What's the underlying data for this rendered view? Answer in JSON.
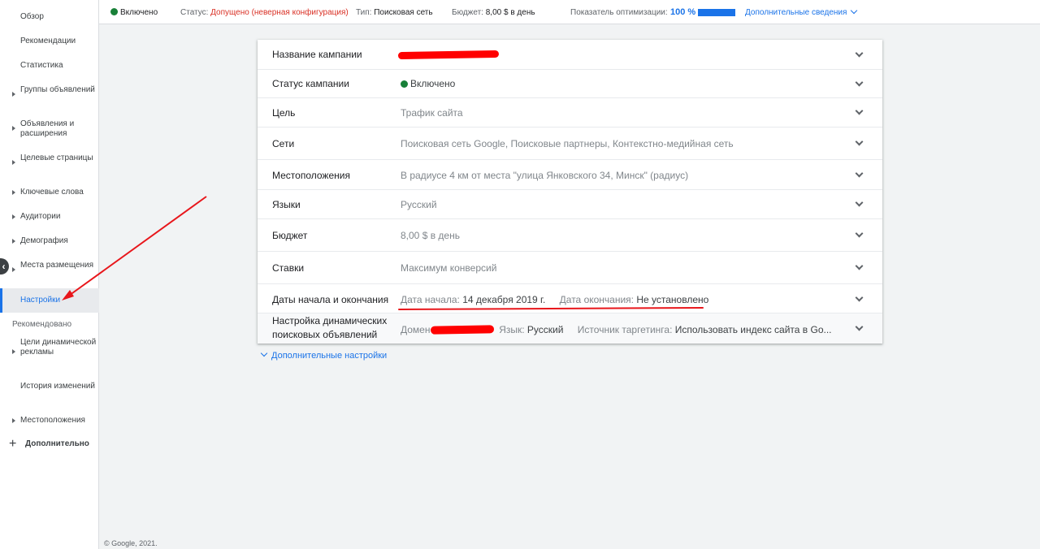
{
  "sidebar": {
    "items": [
      {
        "label": "Обзор"
      },
      {
        "label": "Рекомендации"
      },
      {
        "label": "Статистика"
      },
      {
        "label": "Группы объявлений"
      },
      {
        "label": "Объявления и расширения"
      },
      {
        "label": "Целевые страницы"
      },
      {
        "label": "Ключевые слова"
      },
      {
        "label": "Аудитории"
      },
      {
        "label": "Демография"
      },
      {
        "label": "Места размещения"
      },
      {
        "label": "Настройки"
      },
      {
        "label": "Цели динамической рекламы"
      },
      {
        "label": "История изменений"
      },
      {
        "label": "Местоположения"
      }
    ],
    "section_label": "Рекомендовано",
    "more_label": "Дополнительно"
  },
  "topbar": {
    "enabled": "Включено",
    "status_label": "Статус:",
    "status_value": "Допущено (неверная конфигурация)",
    "type_label": "Тип:",
    "type_value": "Поисковая сеть",
    "budget_label": "Бюджет:",
    "budget_value": "8,00 $ в день",
    "optimization_label": "Показатель оптимизации:",
    "optimization_value": "100 %",
    "optimization_fraction": 1.0,
    "more_details": "Дополнительные сведения"
  },
  "settings": {
    "campaign_name": {
      "label": "Название кампании"
    },
    "campaign_status": {
      "label": "Статус кампании",
      "value": "Включено"
    },
    "goal": {
      "label": "Цель",
      "value": "Трафик сайта"
    },
    "networks": {
      "label": "Сети",
      "value": "Поисковая сеть Google, Поисковые партнеры, Контекстно-медийная сеть"
    },
    "locations": {
      "label": "Местоположения",
      "value": "В радиусе 4 км от места \"улица Янковского 34, Минск\" (радиус)"
    },
    "languages": {
      "label": "Языки",
      "value": "Русский"
    },
    "budget": {
      "label": "Бюджет",
      "value": "8,00 $ в день"
    },
    "bidding": {
      "label": "Ставки",
      "value": "Максимум конверсий"
    },
    "dates": {
      "label": "Даты начала и окончания",
      "start_label": "Дата начала:",
      "start_value": "14 декабря 2019 г.",
      "end_label": "Дата окончания:",
      "end_value": "Не установлено"
    },
    "dsa": {
      "label": "Настройка динамических поисковых объявлений",
      "domain_label": "Домен",
      "lang_label": "Язык:",
      "lang_value": "Русский",
      "source_label": "Источник таргетинга:",
      "source_value": "Использовать индекс сайта в Go..."
    }
  },
  "additional_settings": "Дополнительные настройки",
  "footer": "© Google, 2021.",
  "colors": {
    "accent": "#1a73e8",
    "enabled": "#188038",
    "status_warning": "#d93025",
    "annotation": "#e8161b"
  }
}
